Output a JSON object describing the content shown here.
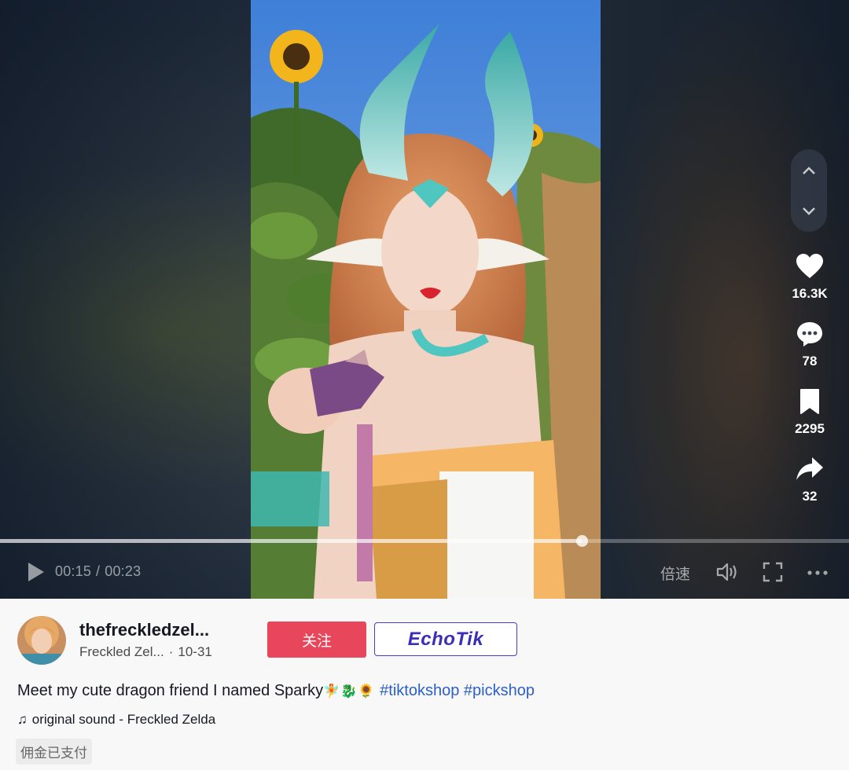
{
  "player": {
    "current_time": "00:15",
    "duration": "00:23",
    "time_separator": "/",
    "speed_label": "倍速",
    "progress_fraction": 0.685
  },
  "actions": {
    "likes": "16.3K",
    "comments": "78",
    "saves": "2295",
    "shares": "32"
  },
  "author": {
    "username": "thefreckledzel...",
    "display_name": "Freckled Zel...",
    "date": "10-31",
    "meta_separator": "·"
  },
  "buttons": {
    "follow_label": "关注",
    "echotik_label": "EchoTik"
  },
  "caption": {
    "text": "Meet my cute dragon friend I named Sparky",
    "emojis": "🧚🐉🌻",
    "hashtags": [
      "#tiktokshop",
      "#pickshop"
    ]
  },
  "sound": {
    "icon": "music-note-icon",
    "label": "original sound - Freckled Zelda"
  },
  "tag": {
    "label": "佣金已支付"
  },
  "colors": {
    "follow_button": "#e8465a",
    "echotik_border": "#4a3ccd",
    "hashtag": "#2b5fc9"
  }
}
